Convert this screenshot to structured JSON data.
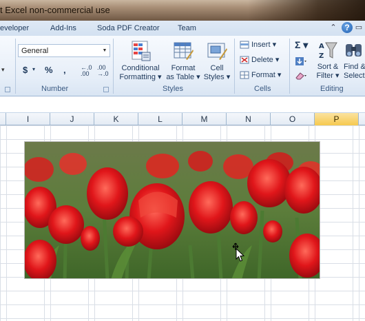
{
  "title_bar": {
    "title": "t Excel non-commercial use"
  },
  "tabs": [
    "eveloper",
    "Add-Ins",
    "Soda PDF Creator",
    "Team"
  ],
  "number_group": {
    "format_value": "General",
    "currency_label": "$",
    "percent_label": "%",
    "comma_label": ",",
    "decrease_decimal_label": "←.0 .00",
    "increase_decimal_label": ".00 →.0",
    "label": "Number"
  },
  "styles_group": {
    "conditional_formatting": [
      "Conditional",
      "Formatting ▾"
    ],
    "format_as_table": [
      "Format",
      "as Table ▾"
    ],
    "cell_styles": [
      "Cell",
      "Styles ▾"
    ],
    "label": "Styles"
  },
  "cells_group": {
    "insert": "Insert ▾",
    "delete": "Delete ▾",
    "format": "Format ▾",
    "label": "Cells"
  },
  "editing_group": {
    "sum_label": "Σ ▾",
    "sort_filter": [
      "Sort &",
      "Filter ▾"
    ],
    "find_select": [
      "Find &",
      "Select ▾"
    ],
    "label": "Editing"
  },
  "columns": [
    "I",
    "J",
    "K",
    "L",
    "M",
    "N",
    "O",
    "P"
  ],
  "selected_column": "P",
  "colors": {
    "ribbon": "#e6eef8",
    "selected_column": "#f6c94f",
    "tulip_red": "#e0161a",
    "stem_green": "#4c7a32"
  }
}
